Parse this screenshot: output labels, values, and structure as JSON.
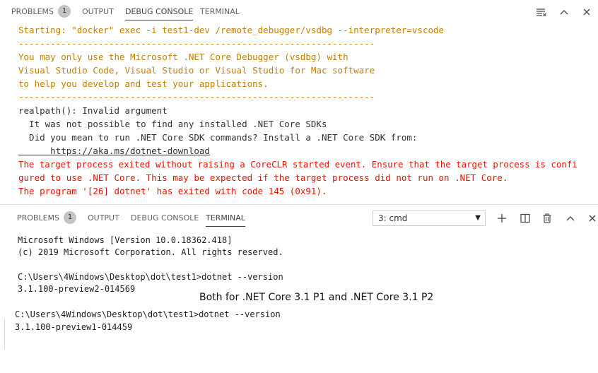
{
  "debug_panel": {
    "tabs": [
      {
        "label": "PROBLEMS",
        "badge": "1"
      },
      {
        "label": "OUTPUT"
      },
      {
        "label": "DEBUG CONSOLE"
      },
      {
        "label": "TERMINAL"
      }
    ],
    "active_tab": "DEBUG CONSOLE",
    "lines": [
      {
        "text": "Starting: \"docker\" exec -i test1-dev /remote_debugger/vsdbg --interpreter=vscode",
        "color": "orange"
      },
      {
        "text": "-------------------------------------------------------------------",
        "color": "orange"
      },
      {
        "text": "You may only use the Microsoft .NET Core Debugger (vsdbg) with",
        "color": "orange"
      },
      {
        "text": "Visual Studio Code, Visual Studio or Visual Studio for Mac software",
        "color": "orange"
      },
      {
        "text": "to help you develop and test your applications.",
        "color": "orange"
      },
      {
        "text": "-------------------------------------------------------------------",
        "color": "orange"
      },
      {
        "text": "realpath(): Invalid argument",
        "color": "dark"
      },
      {
        "text": "  It was not possible to find any installed .NET Core SDKs",
        "color": "dark"
      },
      {
        "text": "  Did you mean to run .NET Core SDK commands? Install a .NET Core SDK from:",
        "color": "dark"
      },
      {
        "text": "      https://aka.ms/dotnet-download",
        "color": "link"
      },
      {
        "text": "The target process exited without raising a CoreCLR started event. Ensure that the target process is confi",
        "color": "red"
      },
      {
        "text": "gured to use .NET Core. This may be expected if the target process did not run on .NET Core.",
        "color": "red"
      },
      {
        "text": "The program '[26] dotnet' has exited with code 145 (0x91).",
        "color": "red"
      }
    ]
  },
  "terminal_panel": {
    "tabs": [
      {
        "label": "PROBLEMS",
        "badge": "1"
      },
      {
        "label": "OUTPUT"
      },
      {
        "label": "DEBUG CONSOLE"
      },
      {
        "label": "TERMINAL"
      }
    ],
    "active_tab": "TERMINAL",
    "selected_terminal": "3: cmd",
    "lines": [
      "Microsoft Windows [Version 10.0.18362.418]",
      "(c) 2019 Microsoft Corporation. All rights reserved.",
      "",
      "C:\\Users\\4Windows\\Desktop\\dot\\test1>dotnet --version",
      "3.1.100-preview2-014569"
    ],
    "lines2": [
      "C:\\Users\\4Windows\\Desktop\\dot\\test1>dotnet --version",
      "3.1.100-preview1-014459"
    ]
  },
  "annotation": "Both for .NET Core 3.1 P1 and .NET Core 3.1 P2",
  "colors": {
    "orange": "#c57f00",
    "red": "#e51400",
    "dark": "#333333",
    "badge": "#c4c4c4"
  },
  "icons": [
    "filter-list-icon",
    "chevron-up-icon",
    "close-icon",
    "plus-icon",
    "split-icon",
    "trash-icon",
    "chevron-up-icon",
    "close-icon"
  ]
}
